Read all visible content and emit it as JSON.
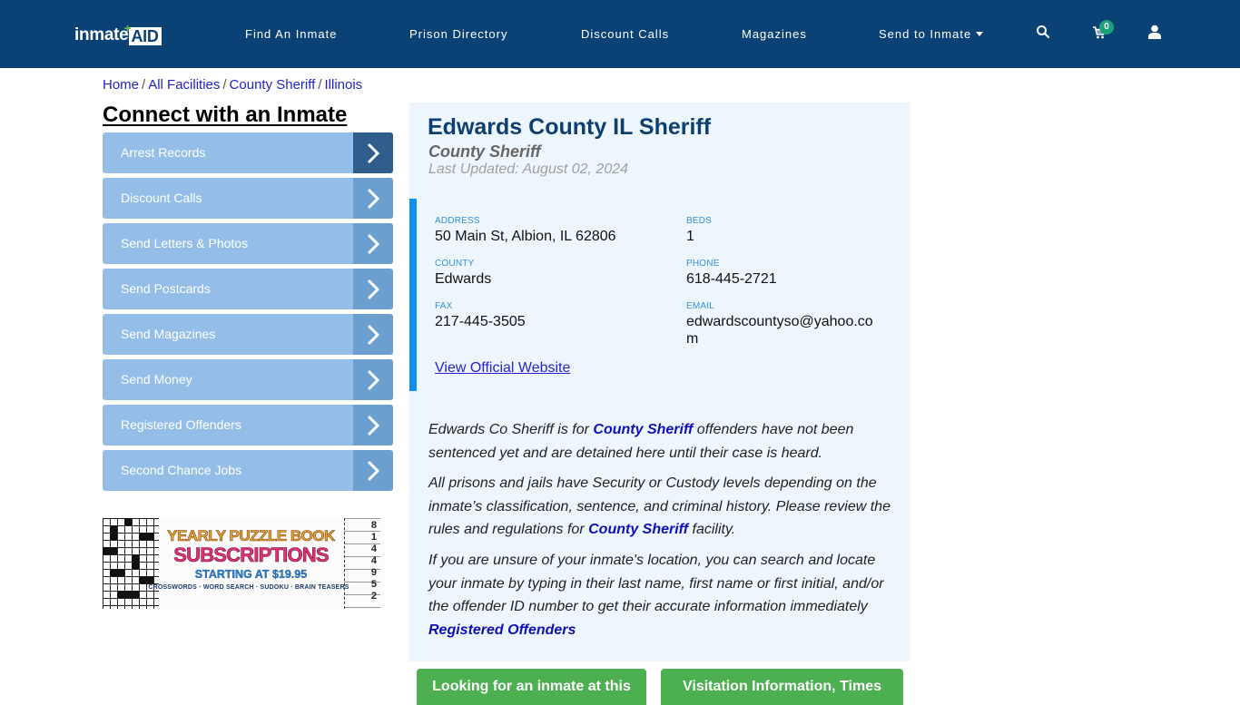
{
  "header": {
    "logo_part1": "inmate",
    "logo_part2": "AID",
    "logo_plus": "+",
    "nav": [
      {
        "label": "Find An Inmate"
      },
      {
        "label": "Prison Directory"
      },
      {
        "label": "Discount Calls"
      },
      {
        "label": "Magazines"
      },
      {
        "label": "Send to Inmate",
        "has_dropdown": true
      }
    ],
    "icons": [
      "search-icon",
      "cart-icon",
      "user-icon"
    ],
    "cart_count": "0",
    "colors": {
      "navbar": "#0a4275",
      "badge": "#1aa37a"
    }
  },
  "breadcrumb": [
    {
      "label": "Home"
    },
    {
      "label": "All Facilities"
    },
    {
      "label": "County Sheriff"
    },
    {
      "label": "Illinois"
    }
  ],
  "breadcrumb_separator": "/",
  "sidebar": {
    "title": "Connect with an Inmate",
    "items": [
      {
        "label": "Arrest Records",
        "active": true
      },
      {
        "label": "Discount Calls"
      },
      {
        "label": "Send Letters & Photos"
      },
      {
        "label": "Send Postcards"
      },
      {
        "label": "Send Magazines"
      },
      {
        "label": "Send Money"
      },
      {
        "label": "Registered Offenders"
      },
      {
        "label": "Second Chance Jobs"
      }
    ],
    "ad": {
      "line1": "YEARLY PUZZLE BOOK",
      "line2": "SUBSCRIPTIONS",
      "line3": "STARTING AT $19.95",
      "line4": "CROSSWORDS · WORD SEARCH · SUDOKU · BRAIN TEASERS",
      "sudoku_digits": "8\n1\n4\n4\n9\n5\n2"
    }
  },
  "facility": {
    "name": "Edwards County IL Sheriff",
    "type": "County Sheriff",
    "last_updated": "Last Updated: August 02, 2024",
    "fields": {
      "address": {
        "label": "ADDRESS",
        "value": "50 Main St, Albion, IL 62806"
      },
      "beds": {
        "label": "BEDS",
        "value": "1"
      },
      "county": {
        "label": "COUNTY",
        "value": "Edwards"
      },
      "phone": {
        "label": "PHONE",
        "value": "618-445-2721"
      },
      "fax": {
        "label": "FAX",
        "value": "217-445-3505"
      },
      "email": {
        "label": "EMAIL",
        "value": "edwardscountyso@yahoo.co m"
      }
    },
    "website_link": "View Official Website",
    "description": {
      "p1_a": "Edwards Co Sheriff is for ",
      "p1_link": "County Sheriff",
      "p1_b": " offenders have not been sentenced yet and are detained here until their case is heard.",
      "p2_a": "All prisons and jails have Security or Custody levels depending on the inmate’s classification, sentence, and criminal history. Please review the rules and regulations for ",
      "p2_link": "County Sheriff",
      "p2_b": " facility.",
      "p3": "If you are unsure of your inmate's location, you can search and locate your inmate by typing in their last name, first name or first initial, and/or the offender ID number to get their accurate information immediately",
      "p3_link": "Registered Offenders"
    }
  },
  "buttons": {
    "looking": "Looking for an inmate at this",
    "visitation": "Visitation Information, Times"
  }
}
